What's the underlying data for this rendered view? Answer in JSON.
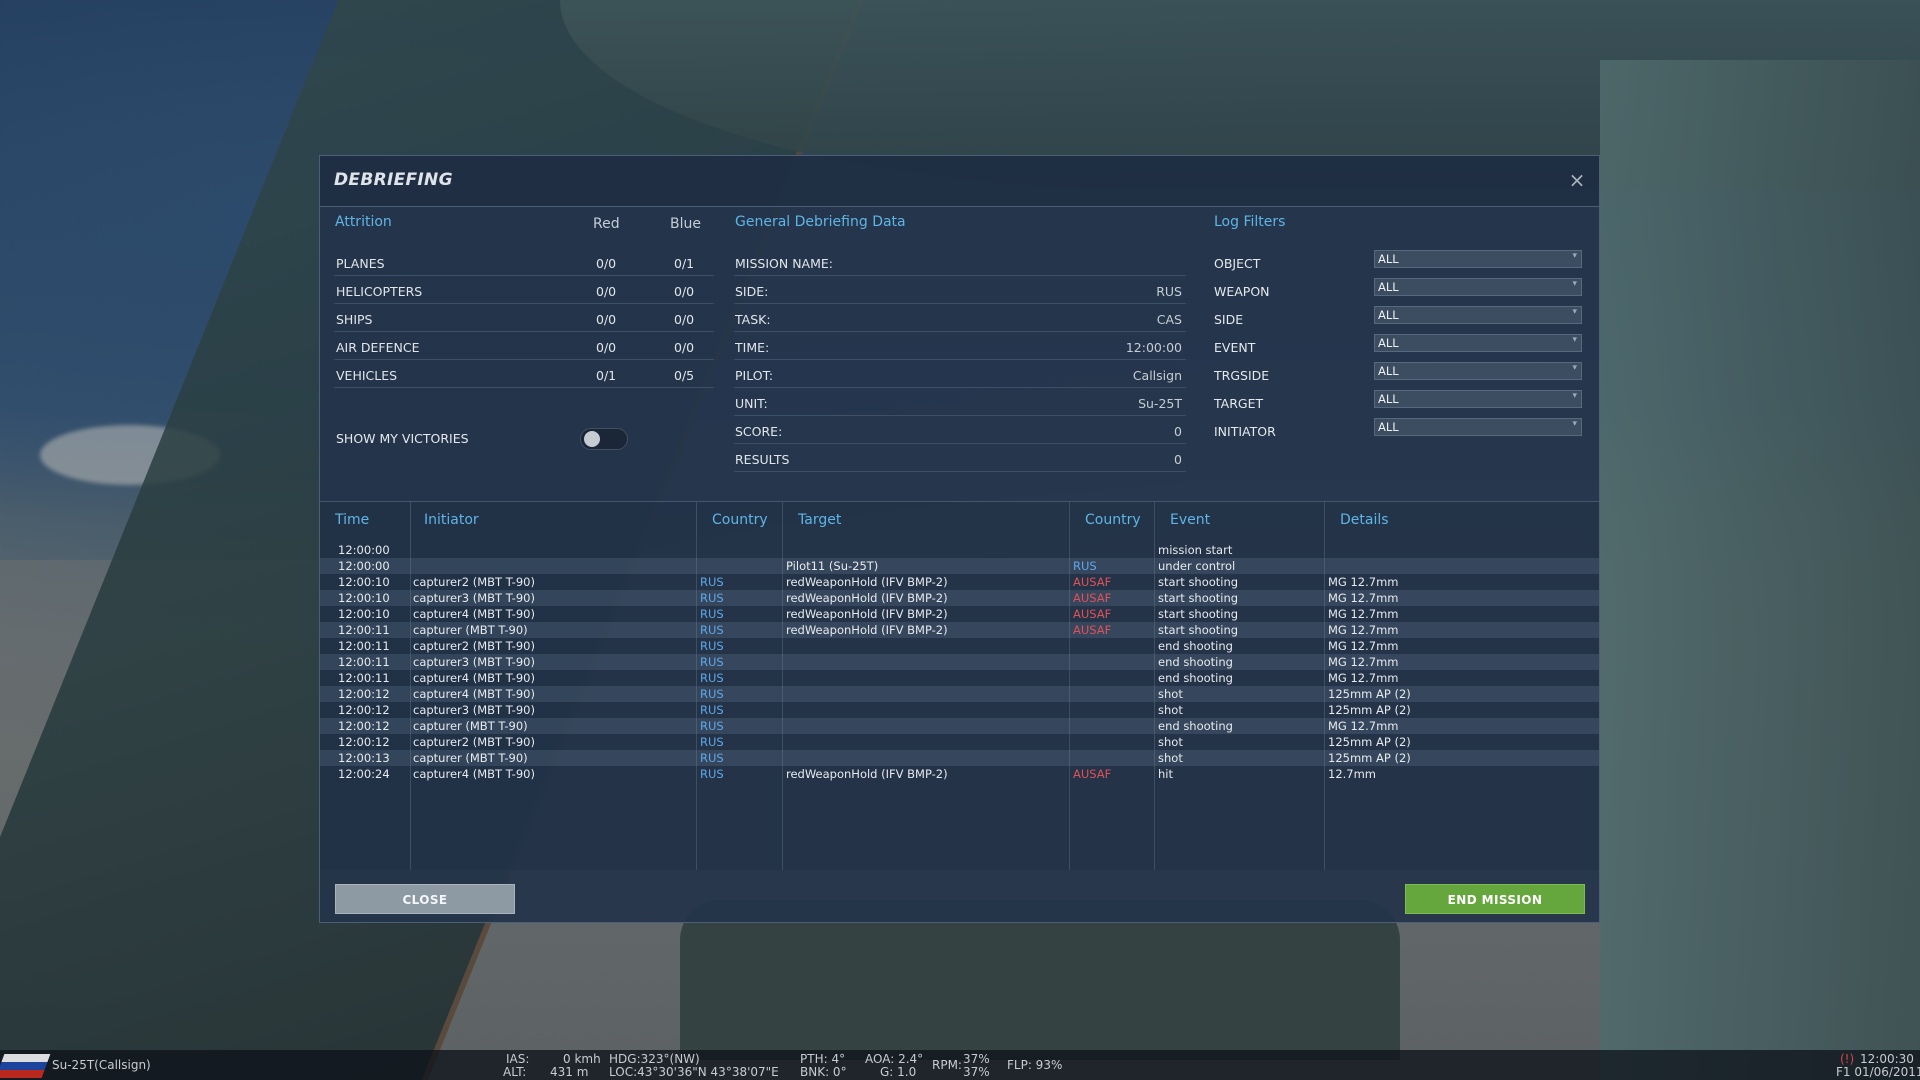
{
  "dialog": {
    "title": "DEBRIEFING",
    "close_icon": "×"
  },
  "attrition": {
    "title": "Attrition",
    "col_red": "Red",
    "col_blue": "Blue",
    "rows": [
      {
        "label": "PLANES",
        "red": "0/0",
        "blue": "0/1"
      },
      {
        "label": "HELICOPTERS",
        "red": "0/0",
        "blue": "0/0"
      },
      {
        "label": "SHIPS",
        "red": "0/0",
        "blue": "0/0"
      },
      {
        "label": "AIR DEFENCE",
        "red": "0/0",
        "blue": "0/0"
      },
      {
        "label": "VEHICLES",
        "red": "0/1",
        "blue": "0/5"
      }
    ],
    "show_victories_label": "SHOW MY VICTORIES",
    "show_victories_on": false
  },
  "general": {
    "title": "General Debriefing Data",
    "rows": [
      {
        "label": "MISSION NAME:",
        "value": ""
      },
      {
        "label": "SIDE:",
        "value": "RUS"
      },
      {
        "label": "TASK:",
        "value": "CAS"
      },
      {
        "label": "TIME:",
        "value": "12:00:00"
      },
      {
        "label": "PILOT:",
        "value": "Callsign"
      },
      {
        "label": "UNIT:",
        "value": "Su-25T"
      },
      {
        "label": "SCORE:",
        "value": "0"
      },
      {
        "label": "RESULTS",
        "value": "0"
      }
    ]
  },
  "filters": {
    "title": "Log Filters",
    "rows": [
      {
        "label": "OBJECT",
        "value": "ALL"
      },
      {
        "label": "WEAPON",
        "value": "ALL"
      },
      {
        "label": "SIDE",
        "value": "ALL"
      },
      {
        "label": "EVENT",
        "value": "ALL"
      },
      {
        "label": "TRGSIDE",
        "value": "ALL"
      },
      {
        "label": "TARGET",
        "value": "ALL"
      },
      {
        "label": "INITIATOR",
        "value": "ALL"
      }
    ]
  },
  "log": {
    "headers": {
      "time": "Time",
      "initiator": "Initiator",
      "country": "Country",
      "target": "Target",
      "target_country": "Country",
      "event": "Event",
      "details": "Details"
    },
    "rows": [
      {
        "time": "12:00:00",
        "initiator": "",
        "country": "",
        "target": "",
        "target_country": "",
        "event": "mission start",
        "details": ""
      },
      {
        "time": "12:00:00",
        "initiator": "",
        "country": "",
        "target": "Pilot11 (Su-25T)",
        "target_country": "RUS",
        "event": "under control",
        "details": ""
      },
      {
        "time": "12:00:10",
        "initiator": "capturer2 (MBT T-90)",
        "country": "RUS",
        "target": "redWeaponHold (IFV BMP-2)",
        "target_country": "AUSAF",
        "event": "start shooting",
        "details": "MG 12.7mm"
      },
      {
        "time": "12:00:10",
        "initiator": "capturer3 (MBT T-90)",
        "country": "RUS",
        "target": "redWeaponHold (IFV BMP-2)",
        "target_country": "AUSAF",
        "event": "start shooting",
        "details": "MG 12.7mm"
      },
      {
        "time": "12:00:10",
        "initiator": "capturer4 (MBT T-90)",
        "country": "RUS",
        "target": "redWeaponHold (IFV BMP-2)",
        "target_country": "AUSAF",
        "event": "start shooting",
        "details": "MG 12.7mm"
      },
      {
        "time": "12:00:11",
        "initiator": "capturer (MBT T-90)",
        "country": "RUS",
        "target": "redWeaponHold (IFV BMP-2)",
        "target_country": "AUSAF",
        "event": "start shooting",
        "details": "MG 12.7mm"
      },
      {
        "time": "12:00:11",
        "initiator": "capturer2 (MBT T-90)",
        "country": "RUS",
        "target": "",
        "target_country": "",
        "event": "end shooting",
        "details": "MG 12.7mm"
      },
      {
        "time": "12:00:11",
        "initiator": "capturer3 (MBT T-90)",
        "country": "RUS",
        "target": "",
        "target_country": "",
        "event": "end shooting",
        "details": "MG 12.7mm"
      },
      {
        "time": "12:00:11",
        "initiator": "capturer4 (MBT T-90)",
        "country": "RUS",
        "target": "",
        "target_country": "",
        "event": "end shooting",
        "details": "MG 12.7mm"
      },
      {
        "time": "12:00:12",
        "initiator": "capturer4 (MBT T-90)",
        "country": "RUS",
        "target": "",
        "target_country": "",
        "event": "shot",
        "details": "125mm AP (2)"
      },
      {
        "time": "12:00:12",
        "initiator": "capturer3 (MBT T-90)",
        "country": "RUS",
        "target": "",
        "target_country": "",
        "event": "shot",
        "details": "125mm AP (2)"
      },
      {
        "time": "12:00:12",
        "initiator": "capturer (MBT T-90)",
        "country": "RUS",
        "target": "",
        "target_country": "",
        "event": "end shooting",
        "details": "MG 12.7mm"
      },
      {
        "time": "12:00:12",
        "initiator": "capturer2 (MBT T-90)",
        "country": "RUS",
        "target": "",
        "target_country": "",
        "event": "shot",
        "details": "125mm AP (2)"
      },
      {
        "time": "12:00:13",
        "initiator": "capturer (MBT T-90)",
        "country": "RUS",
        "target": "",
        "target_country": "",
        "event": "shot",
        "details": "125mm AP (2)"
      },
      {
        "time": "12:00:24",
        "initiator": "capturer4 (MBT T-90)",
        "country": "RUS",
        "target": "redWeaponHold (IFV BMP-2)",
        "target_country": "AUSAF",
        "event": "hit",
        "details": "12.7mm"
      }
    ]
  },
  "buttons": {
    "close": "CLOSE",
    "end_mission": "END MISSION"
  },
  "colors": {
    "accent": "#5fb5e6",
    "rus": "#5fa8e8",
    "ausaf": "#e0525a",
    "end_mission": "#66a73d"
  },
  "status": {
    "unit": "Su-25T(Callsign)",
    "ias_label": "IAS:",
    "ias_value": "0 kmh",
    "alt_label": "ALT:",
    "alt_value": "431 m",
    "hdg": "HDG:323°(NW)",
    "loc": "LOC:43°30'36\"N 43°38'07\"E",
    "pth": "PTH: 4°",
    "bnk": "BNK: 0°",
    "aoa": "AOA: 2.4°",
    "g": "G: 1.0",
    "rpm_label": "RPM:",
    "rpm1": "37%",
    "rpm2": "37%",
    "flp": "FLP: 93%",
    "pause": "(!)",
    "clock": "12:00:30",
    "date": "F1 01/06/2011"
  }
}
